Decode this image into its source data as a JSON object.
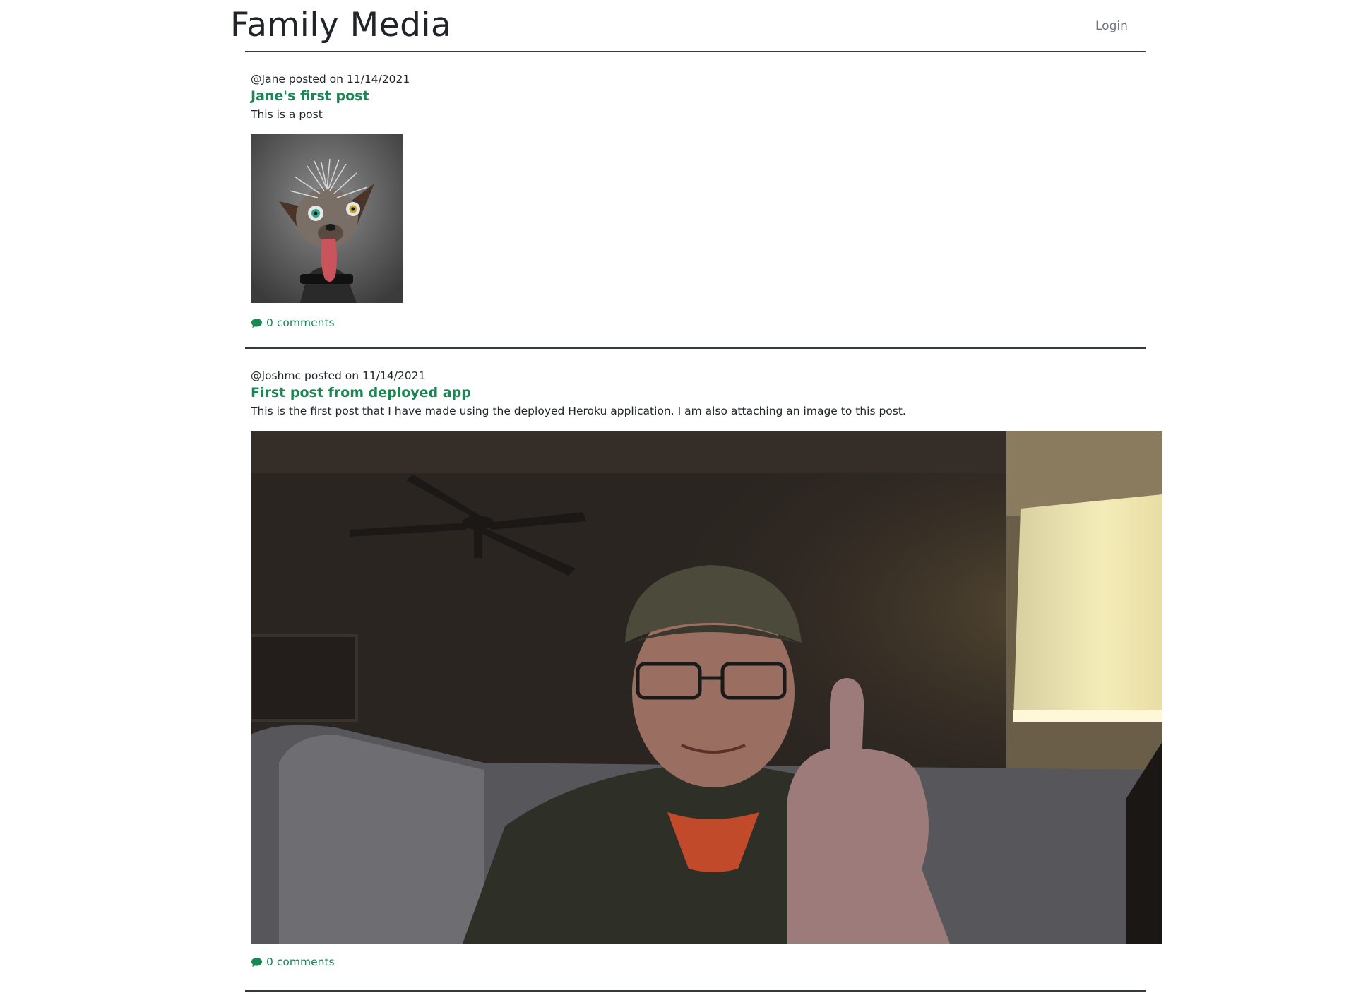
{
  "header": {
    "app_title": "Family Media",
    "login_label": "Login"
  },
  "posts": [
    {
      "author": "@Jane",
      "posted_on_label": "posted on",
      "date": "11/14/2021",
      "title": "Jane's first post",
      "body": "This is a post",
      "image": "portrait of a scruffy hairless dog with bulging eyes and tongue out",
      "comments_count": 0,
      "comments_label": "comments"
    },
    {
      "author": "@Joshmc",
      "posted_on_label": "posted on",
      "date": "11/14/2021",
      "title": "First post from deployed app",
      "body": "This is the first post that I have made using the deployed Heroku application. I am also attaching an image to this post.",
      "image": "man in a cap and glasses giving a thumbs up in a dim living room with a lamp",
      "comments_count": 0,
      "comments_label": "comments"
    }
  ],
  "colors": {
    "accent": "#198754",
    "text": "#212529",
    "muted": "#6c757d",
    "rule": "#343a40"
  },
  "icons": {
    "comment": "comment-bubble-icon"
  }
}
